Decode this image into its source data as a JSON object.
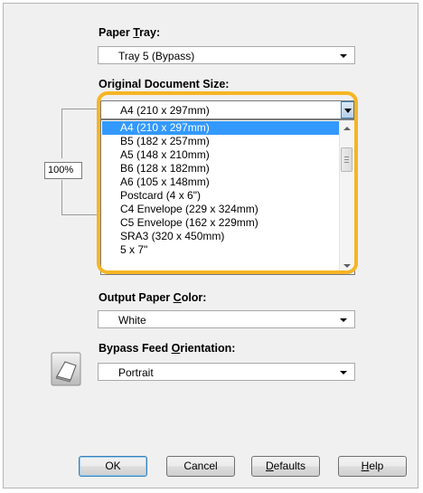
{
  "paper_tray": {
    "label_pre": "Paper ",
    "label_u": "T",
    "label_post": "ray:",
    "value": "Tray 5 (Bypass)"
  },
  "original_document_size": {
    "label": "Original Document Size:",
    "selected": "A4 (210 x 297mm)",
    "options": [
      "A4 (210 x 297mm)",
      "B5 (182 x 257mm)",
      "A5 (148 x 210mm)",
      "B6 (128 x 182mm)",
      "A6 (105 x 148mm)",
      "Postcard (4 x 6\")",
      "C4 Envelope (229 x 324mm)",
      "C5 Envelope (162 x 229mm)",
      "SRA3 (320 x 450mm)",
      "5 x 7\""
    ]
  },
  "zoom": {
    "value": "100%"
  },
  "output_paper_color": {
    "label_pre": "Output Paper ",
    "label_u": "C",
    "label_post": "olor:",
    "value": "White"
  },
  "bypass_feed_orientation": {
    "label_pre": "Bypass Feed ",
    "label_u": "O",
    "label_post": "rientation:",
    "value": "Portrait"
  },
  "buttons": {
    "ok": "OK",
    "cancel": "Cancel",
    "defaults_u": "D",
    "defaults_rest": "efaults",
    "help_u": "H",
    "help_rest": "elp"
  },
  "colors": {
    "dialog_bg": "#f0f0f0",
    "selection": "#3399ff",
    "highlight_outline": "#f6b523"
  }
}
